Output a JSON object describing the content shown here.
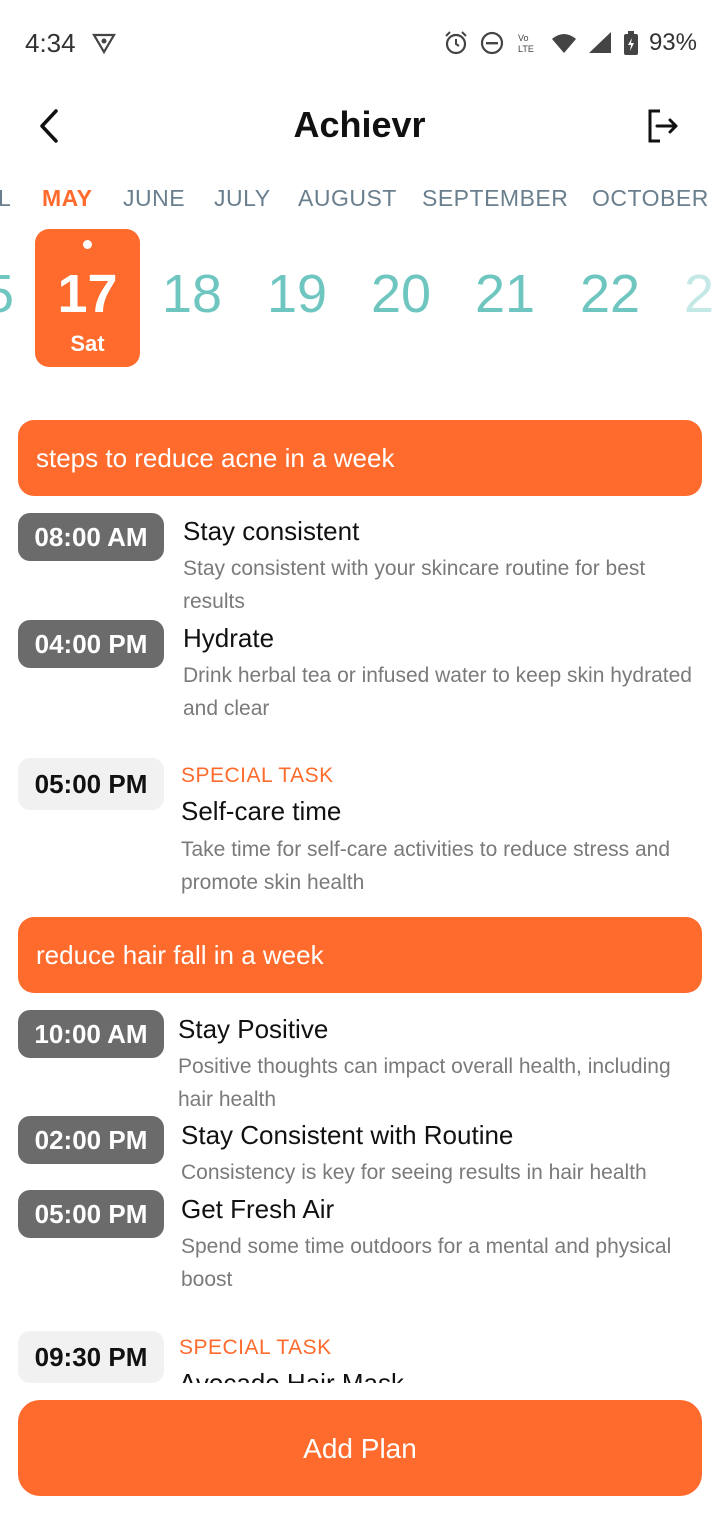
{
  "status_bar": {
    "time": "4:34",
    "battery": "93%",
    "icons": [
      "vpn-shield-icon",
      "alarm-icon",
      "do-not-disturb-icon",
      "volte-icon",
      "wifi-icon",
      "cellular-signal-icon",
      "battery-charging-icon"
    ]
  },
  "app_bar": {
    "title": "Achievr",
    "back_icon": "chevron-left-icon",
    "logout_icon": "logout-icon"
  },
  "months": {
    "partial_left": "L",
    "items": [
      "MAY",
      "JUNE",
      "JULY",
      "AUGUST",
      "SEPTEMBER",
      "OCTOBER"
    ],
    "selected": "MAY"
  },
  "days": {
    "partial_left": "5",
    "selected": {
      "number": "17",
      "weekday": "Sat"
    },
    "items": [
      "18",
      "19",
      "20",
      "21",
      "22"
    ],
    "partial_right": "2"
  },
  "plans": [
    {
      "title": "steps to reduce acne in a week",
      "tasks": [
        {
          "time": "08:00 AM",
          "title": "Stay consistent",
          "description": "Stay consistent with your skincare routine for best results"
        },
        {
          "time": "04:00 PM",
          "title": "Hydrate",
          "description": "Drink herbal tea or infused water to keep skin hydrated and clear"
        },
        {
          "time": "05:00 PM",
          "special_label": "SPECIAL TASK",
          "title": "Self-care time",
          "description": "Take time for self-care activities to reduce stress and promote skin health"
        }
      ]
    },
    {
      "title": "reduce hair fall in a week",
      "tasks": [
        {
          "time": "10:00 AM",
          "title": "Stay Positive",
          "description": "Positive thoughts can impact overall health, including hair health"
        },
        {
          "time": "02:00 PM",
          "title": "Stay Consistent with Routine",
          "description": "Consistency is key for seeing results in hair health"
        },
        {
          "time": "05:00 PM",
          "title": "Get Fresh Air",
          "description": "Spend some time outdoors for a mental and physical boost"
        },
        {
          "time": "09:30 PM",
          "special_label": "SPECIAL TASK",
          "title": "Avocado Hair Mask",
          "description": ""
        }
      ]
    }
  ],
  "add_plan_label": "Add Plan",
  "colors": {
    "accent": "#ff6b2c",
    "day_number": "#6fc6c0",
    "month_text": "#6a7f8e",
    "time_pill": "#6b6b6b",
    "special_pill": "#f1f1f1"
  }
}
